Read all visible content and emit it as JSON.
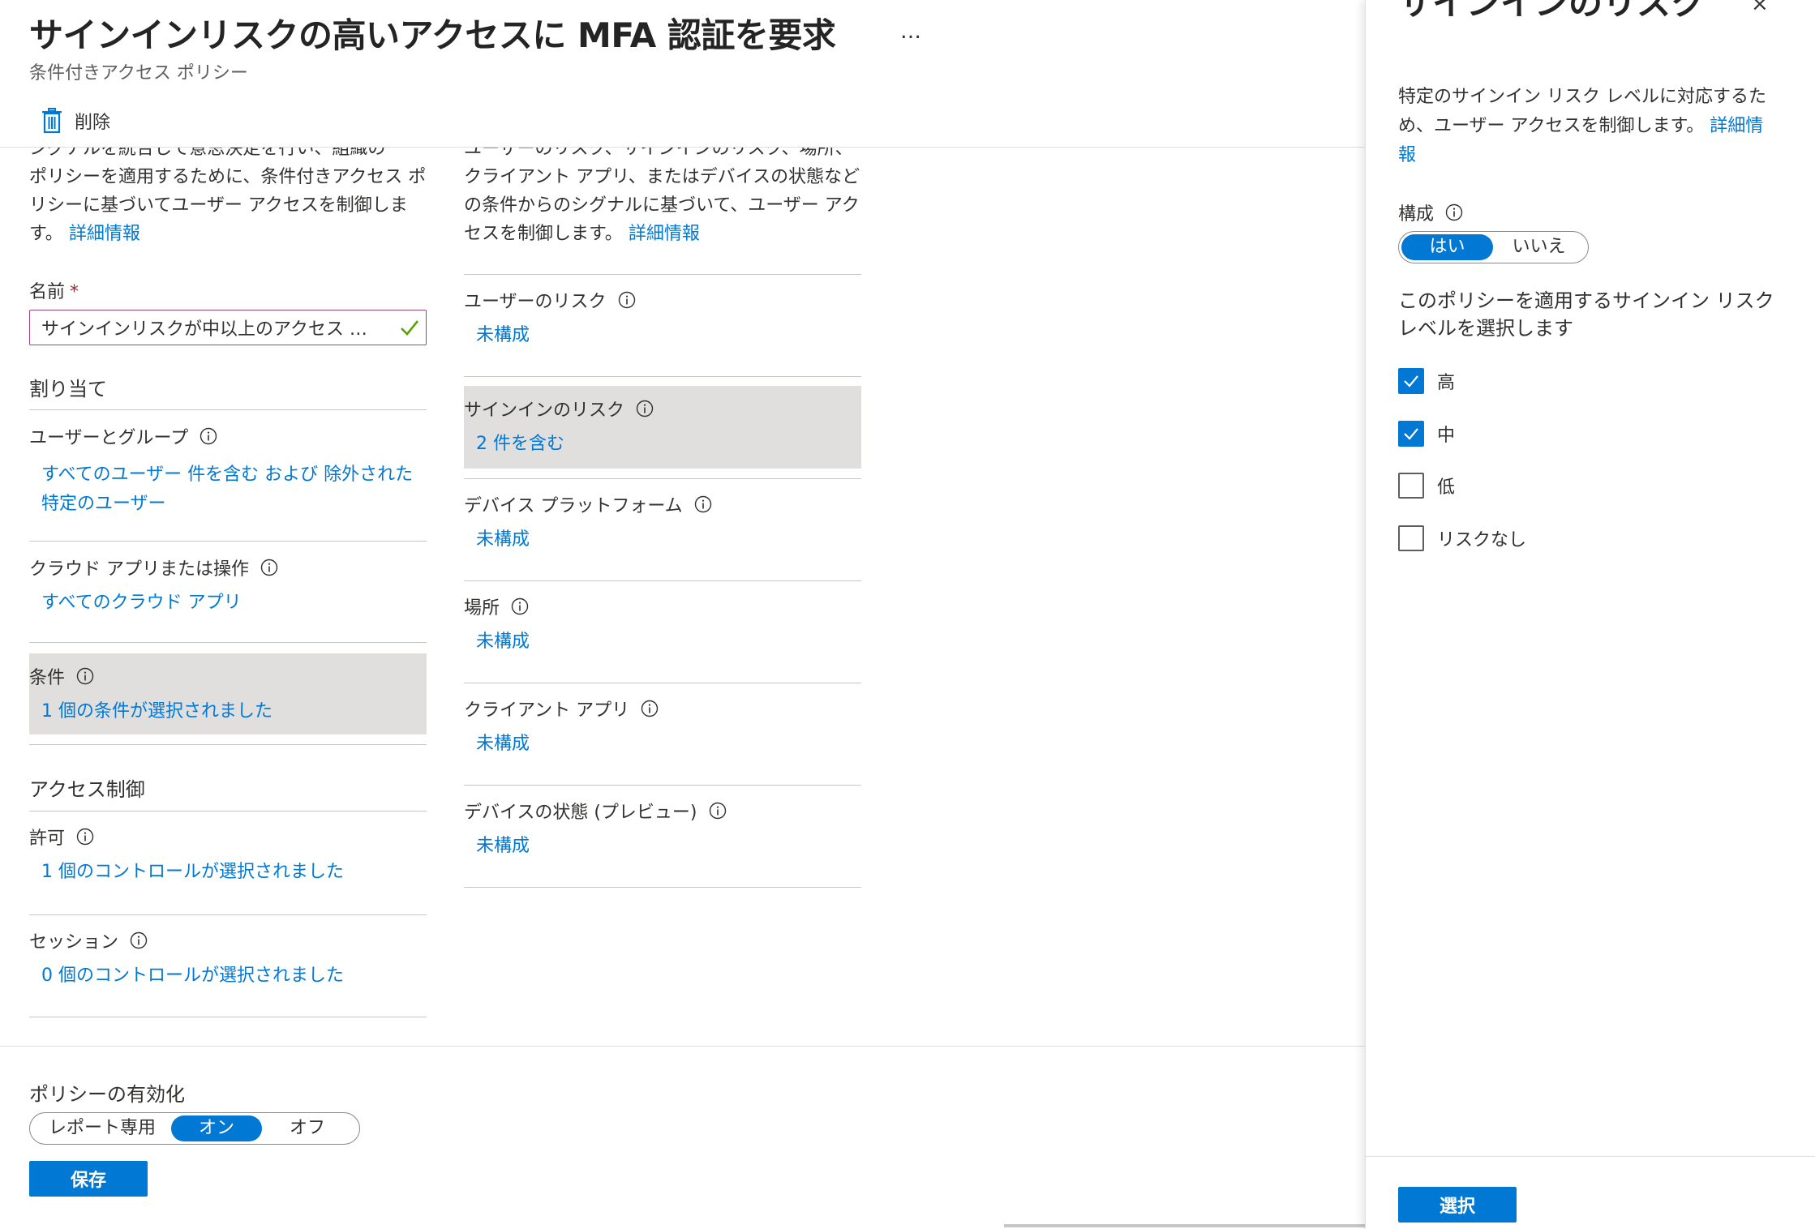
{
  "header": {
    "title": "サインインリスクの高いアクセスに MFA 認証を要求",
    "more": "…",
    "subtitle": "条件付きアクセス ポリシー"
  },
  "toolbar": {
    "delete_label": "削除"
  },
  "left": {
    "desc_hidden": "シグナルを統合して意思決定を行い、組織の",
    "desc": "ポリシーを適用するために、条件付きアクセス ポリシーに基づいてユーザー アクセスを制御します。",
    "desc_link": "詳細情報",
    "name_label": "名前",
    "name_required": "*",
    "name_value": "サインインリスクが中以上のアクセス …",
    "assignments_heading": "割り当て",
    "users_label": "ユーザーとグループ",
    "users_value": "すべてのユーザー 件を含む および 除外された特定のユーザー",
    "apps_label": "クラウド アプリまたは操作",
    "apps_value": "すべてのクラウド アプリ",
    "conditions_label": "条件",
    "conditions_value": "1 個の条件が選択されました",
    "access_heading": "アクセス制御",
    "grant_label": "許可",
    "grant_value": "1 個のコントロールが選択されました",
    "session_label": "セッション",
    "session_value": "0 個のコントロールが選択されました"
  },
  "middle": {
    "desc_hidden": "ユーザーのリスク、サインインのリスク、場所、",
    "desc": "クライアント アプリ、またはデバイスの状態などの条件からのシグナルに基づいて、ユーザー アクセスを制御します。",
    "desc_link": "詳細情報",
    "user_risk_label": "ユーザーのリスク",
    "user_risk_value": "未構成",
    "signin_risk_label": "サインインのリスク",
    "signin_risk_value": "2 件を含む",
    "platform_label": "デバイス プラットフォーム",
    "platform_value": "未構成",
    "location_label": "場所",
    "location_value": "未構成",
    "client_label": "クライアント アプリ",
    "client_value": "未構成",
    "device_state_label": "デバイスの状態 (プレビュー)",
    "device_state_value": "未構成"
  },
  "footer": {
    "enable_label": "ポリシーの有効化",
    "options": [
      "レポート専用",
      "オン",
      "オフ"
    ],
    "selected": "オン",
    "save_label": "保存"
  },
  "panel": {
    "title": "サインインのリスク",
    "close": "×",
    "desc": "特定のサインイン リスク レベルに対応するため、ユーザー アクセスを制御します。",
    "desc_link": "詳細情報",
    "config_label": "構成",
    "config_yes": "はい",
    "config_no": "いいえ",
    "question": "このポリシーを適用するサインイン リスク レベルを選択します",
    "levels": [
      {
        "label": "高",
        "checked": true
      },
      {
        "label": "中",
        "checked": true
      },
      {
        "label": "低",
        "checked": false
      },
      {
        "label": "リスクなし",
        "checked": false
      }
    ],
    "select_label": "選択"
  },
  "colors": {
    "accent": "#0078d4",
    "selected_bg": "#e1dfdd",
    "check_green": "#57a300"
  }
}
